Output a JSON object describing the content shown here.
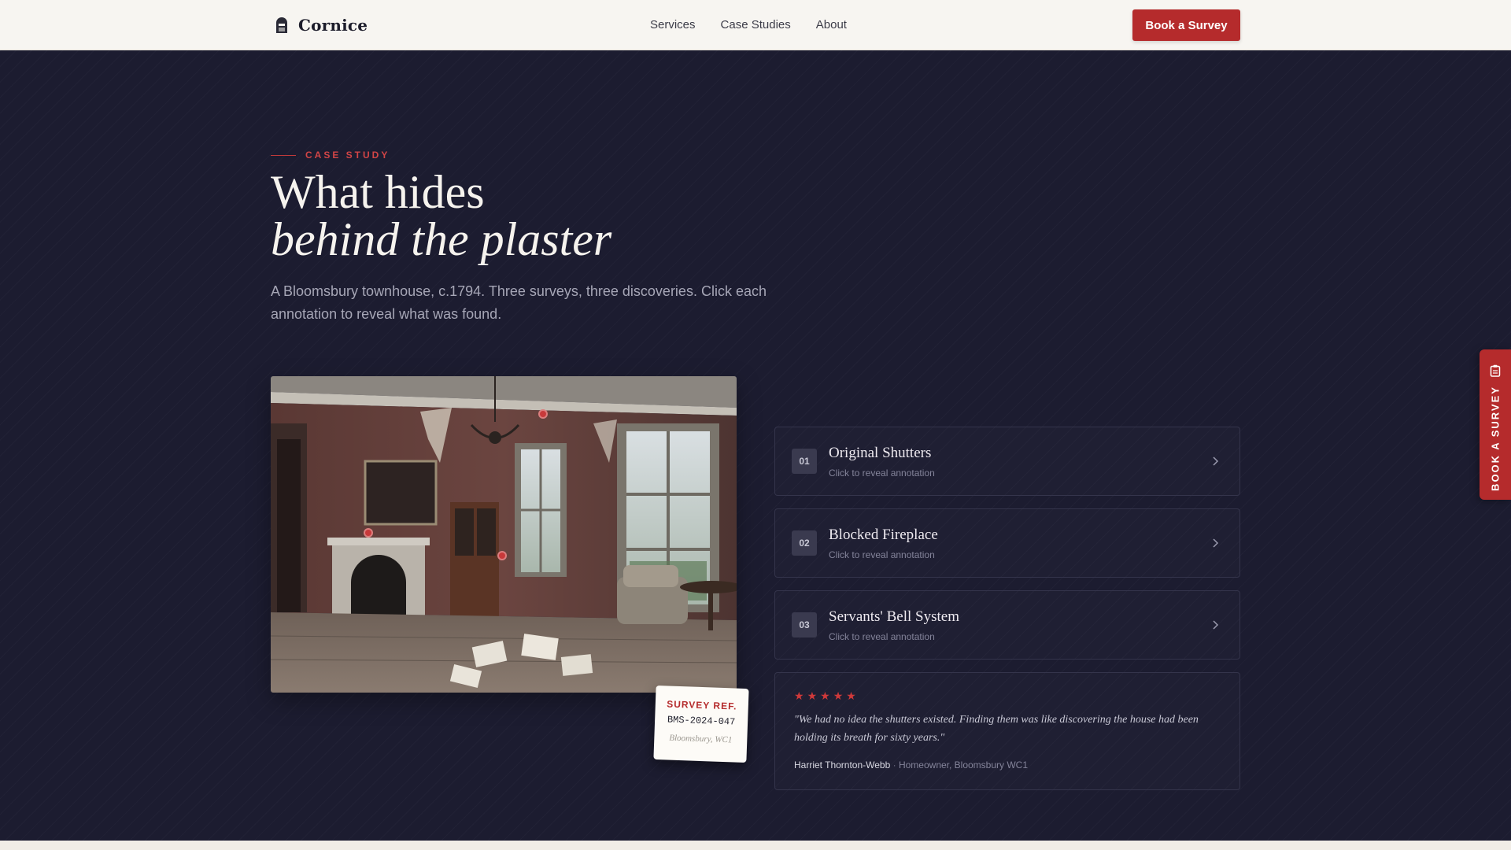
{
  "nav": {
    "brand": "Cornice",
    "brand_icon": "door-icon",
    "links": [
      "Services",
      "Case Studies",
      "About"
    ],
    "cta": "Book a Survey"
  },
  "hero": {
    "eyebrow": "CASE STUDY",
    "headline_line1": "What hides",
    "headline_line2": "behind the plaster",
    "lead": "A Bloomsbury townhouse, c.1794. Three surveys, three discoveries. Click each annotation to reveal what was found."
  },
  "survey_ref": {
    "label": "SURVEY REF.",
    "code": "BMS-2024-047",
    "location": "Bloomsbury, WC1"
  },
  "annotations": [
    {
      "number": "01",
      "title": "Original Shutters",
      "hint": "Click to reveal annotation"
    },
    {
      "number": "02",
      "title": "Blocked Fireplace",
      "hint": "Click to reveal annotation"
    },
    {
      "number": "03",
      "title": "Servants' Bell System",
      "hint": "Click to reveal annotation"
    }
  ],
  "testimonial": {
    "rating": 5,
    "quote": "\"We had no idea the shutters existed. Finding them was like discovering the house had been holding its breath for sixty years.\"",
    "name": "Harriet Thornton-Webb",
    "separator": "·",
    "role": "Homeowner, Bloomsbury WC1"
  },
  "side_tab": {
    "label": "BOOK A SURVEY",
    "icon": "clipboard-icon"
  },
  "colors": {
    "accent": "#b52b2c",
    "hero_bg": "#1c1c30",
    "nav_bg": "#f7f5f1"
  }
}
